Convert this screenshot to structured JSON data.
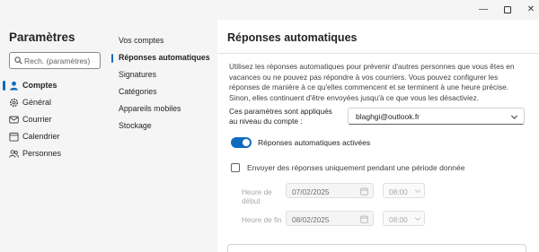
{
  "window": {
    "minimize_glyph": "—",
    "close_glyph": "✕"
  },
  "sidebar": {
    "title": "Paramètres",
    "search": {
      "placeholder": "Rech. (paramètres)"
    },
    "items": [
      {
        "label": "Comptes",
        "icon": "person-icon",
        "active": true
      },
      {
        "label": "Général",
        "icon": "gear-icon",
        "active": false
      },
      {
        "label": "Courrier",
        "icon": "mail-icon",
        "active": false
      },
      {
        "label": "Calendrier",
        "icon": "calendar-icon",
        "active": false
      },
      {
        "label": "Personnes",
        "icon": "people-icon",
        "active": false
      }
    ]
  },
  "subnav": {
    "items": [
      {
        "label": "Vos comptes",
        "active": false
      },
      {
        "label": "Réponses automatiques",
        "active": true
      },
      {
        "label": "Signatures",
        "active": false
      },
      {
        "label": "Catégories",
        "active": false
      },
      {
        "label": "Appareils mobiles",
        "active": false
      },
      {
        "label": "Stockage",
        "active": false
      }
    ]
  },
  "content": {
    "title": "Réponses automatiques",
    "description": "Utilisez les réponses automatiques pour prévenir d'autres personnes que vous êtes en vacances ou ne pouvez pas répondre à vos courriers. Vous pouvez configurer les réponses de manière à ce qu'elles commencent et se terminent à une heure précise. Sinon, elles continuent d'être envoyées jusqu'à ce que vous les désactiviez.",
    "applied_label": "Ces paramètres sont appliqués au niveau du compte :",
    "account": "blaghgi@outlook.fr",
    "toggle": {
      "label": "Réponses automatiques activées",
      "on": true
    },
    "checkbox": {
      "label": "Envoyer des réponses uniquement pendant une période donnée",
      "checked": false
    },
    "start": {
      "label": "Heure de début",
      "date": "07/02/2025",
      "time": "08:00"
    },
    "end": {
      "label": "Heure de fin",
      "date": "08/02/2025",
      "time": "08:00"
    }
  },
  "colors": {
    "accent": "#0f6cbd",
    "pane_bg": "#f5f5f5",
    "content_bg": "#ffffff"
  }
}
